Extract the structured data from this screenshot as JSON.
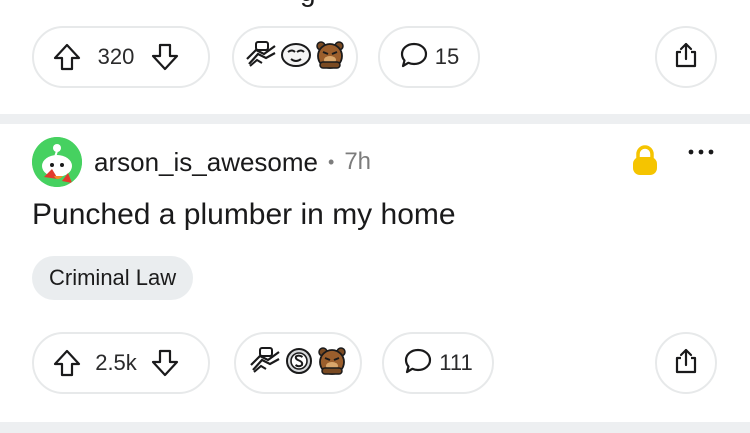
{
  "previous_post": {
    "title_fragment": "g",
    "vote_count": "320",
    "comment_count": "15",
    "awards": [
      "wholesome-handshake-award-icon",
      "ghost-award-icon",
      "angry-bear-award-icon"
    ]
  },
  "post": {
    "username": "arson_is_awesome",
    "separator": "•",
    "age": "7h",
    "title": "Punched a plumber in my home",
    "flair": "Criminal Law",
    "vote_count": "2.5k",
    "comment_count": "111",
    "awards": [
      "wholesome-handshake-award-icon",
      "silver-s-award-icon",
      "angry-bear-award-icon"
    ],
    "locked": true
  },
  "colors": {
    "avatar_bg": "#46d160",
    "lock": "#f5c400",
    "separator_band": "#edeff1",
    "pill_border": "#e7e9ea",
    "flair_bg": "#eaedef",
    "meta_text": "#7c7c7c"
  }
}
